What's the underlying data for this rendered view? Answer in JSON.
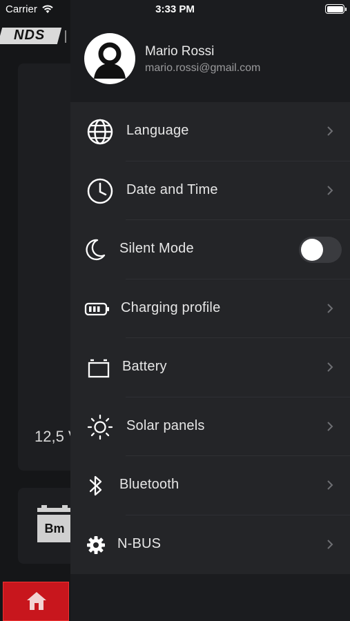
{
  "status_bar": {
    "carrier": "Carrier",
    "time": "3:33 PM"
  },
  "background_app": {
    "logo_text": "NDS",
    "voltage_fragment": "12,5 V",
    "battery_badge": "Bm",
    "brand_color": "#c8161d"
  },
  "drawer": {
    "user": {
      "name": "Mario Rossi",
      "email": "mario.rossi@gmail.com"
    },
    "items": [
      {
        "label": "Language",
        "icon": "globe-icon"
      },
      {
        "label": "Date and Time",
        "icon": "clock-icon"
      },
      {
        "label": "Silent Mode",
        "icon": "moon-icon",
        "toggle_on": false
      },
      {
        "label": "Charging profile",
        "icon": "battery-charge-icon"
      },
      {
        "label": "Battery",
        "icon": "car-battery-icon"
      },
      {
        "label": "Solar panels",
        "icon": "sun-icon"
      },
      {
        "label": "Bluetooth",
        "icon": "bluetooth-icon"
      },
      {
        "label": "N-BUS",
        "icon": "gear-icon"
      }
    ]
  }
}
